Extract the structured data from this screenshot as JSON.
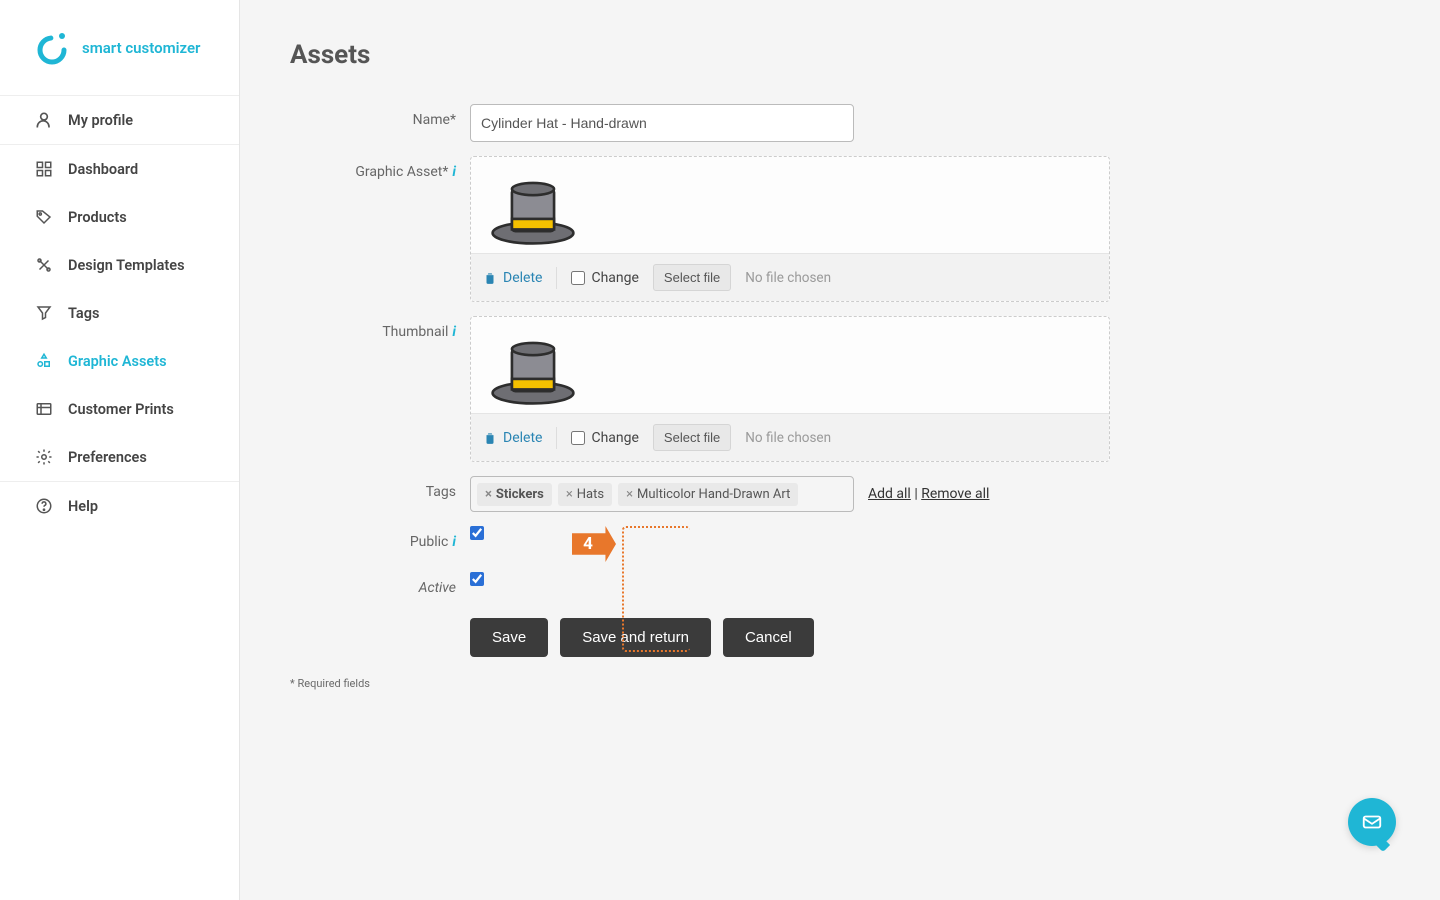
{
  "brand": {
    "text": "smart customizer"
  },
  "sidebar": {
    "profile": "My profile",
    "items": [
      {
        "label": "Dashboard",
        "icon": "dashboard-icon"
      },
      {
        "label": "Products",
        "icon": "tag-icon"
      },
      {
        "label": "Design Templates",
        "icon": "templates-icon"
      },
      {
        "label": "Tags",
        "icon": "filter-icon"
      },
      {
        "label": "Graphic Assets",
        "icon": "assets-icon"
      },
      {
        "label": "Customer Prints",
        "icon": "prints-icon"
      },
      {
        "label": "Preferences",
        "icon": "gear-icon"
      }
    ],
    "help": "Help"
  },
  "page": {
    "title": "Assets"
  },
  "form": {
    "name_label": "Name*",
    "name_value": "Cylinder Hat - Hand-drawn",
    "graphic_label": "Graphic Asset*",
    "thumb_label": "Thumbnail",
    "delete_label": "Delete",
    "change_label": "Change",
    "select_file_label": "Select file",
    "no_file": "No file chosen",
    "tags_label": "Tags",
    "tags": [
      "Stickers",
      "Hats",
      "Multicolor Hand-Drawn Art"
    ],
    "add_all": "Add all",
    "remove_all": "Remove all",
    "public_label": "Public",
    "active_label": "Active",
    "save": "Save",
    "save_return": "Save and return",
    "cancel": "Cancel",
    "required_note": "* Required fields"
  },
  "step": {
    "number": "4"
  }
}
